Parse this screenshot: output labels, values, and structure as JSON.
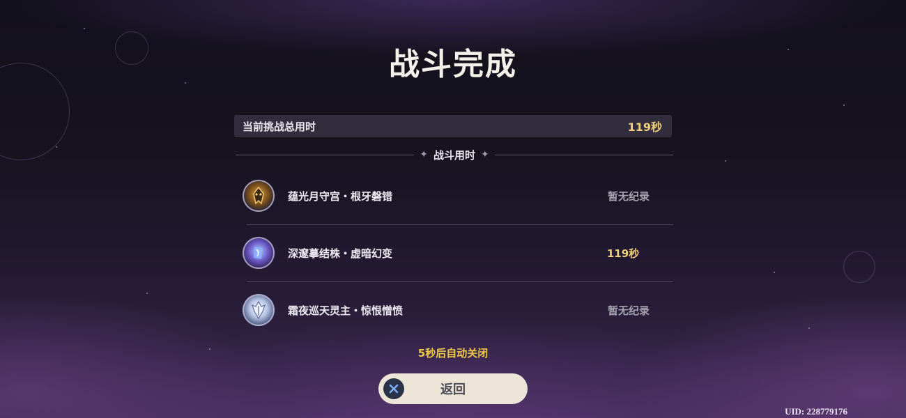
{
  "title": "战斗完成",
  "total": {
    "label": "当前挑战总用时",
    "value": "119秒"
  },
  "section": {
    "label": "战斗用时"
  },
  "bosses": [
    {
      "name": "蕴光月守宫・根牙磐错",
      "record": "暂无纪录"
    },
    {
      "name": "深邃摹结株・虚暗幻变",
      "record": "119秒"
    },
    {
      "name": "霜夜巡天灵主・惊恨憎愤",
      "record": "暂无纪录"
    }
  ],
  "auto_close": "5秒后自动关闭",
  "back_button": {
    "label": "返回"
  },
  "uid": "UID: 228779176",
  "colors": {
    "gold": "#f0cf7e",
    "button_bg": "#ece4d6"
  }
}
